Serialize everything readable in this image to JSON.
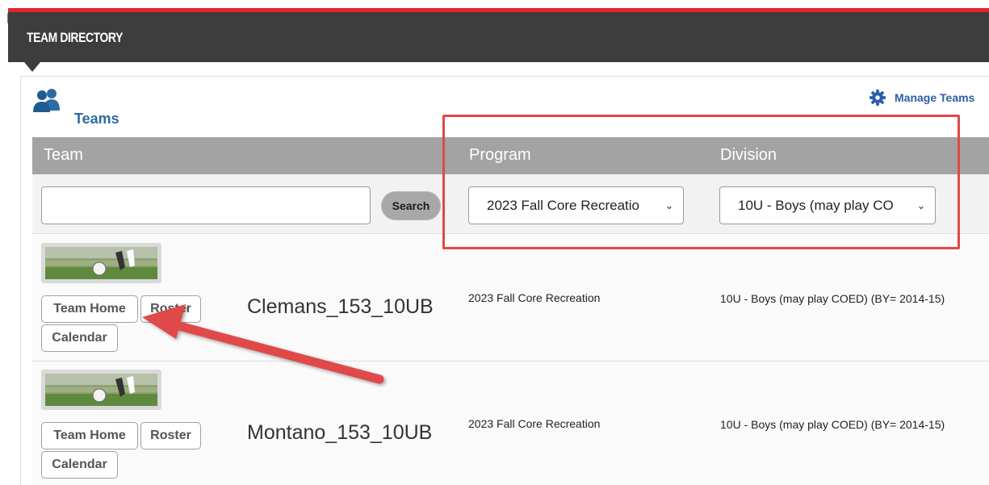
{
  "header": {
    "title": "TEAM DIRECTORY"
  },
  "section": {
    "title": "Teams",
    "manage_label": "Manage Teams"
  },
  "columns": {
    "team": "Team",
    "program": "Program",
    "division": "Division"
  },
  "filters": {
    "team_value": "",
    "search_label": "Search",
    "program_selected": "2023 Fall Core Recreatio",
    "division_selected": "10U - Boys (may play CO"
  },
  "rows": [
    {
      "team_name": "Clemans_153_10UB",
      "program": "2023 Fall Core Recreation",
      "division": "10U - Boys (may play COED) (BY= 2014-15)",
      "buttons": {
        "home": "Team Home",
        "roster": "Roster",
        "calendar": "Calendar"
      }
    },
    {
      "team_name": "Montano_153_10UB",
      "program": "2023 Fall Core Recreation",
      "division": "10U - Boys (may play COED) (BY= 2014-15)",
      "buttons": {
        "home": "Team Home",
        "roster": "Roster",
        "calendar": "Calendar"
      }
    }
  ],
  "colors": {
    "header_bg": "#3d3d3d",
    "accent_red": "#e4262c",
    "link_blue": "#2b5ea8",
    "table_header_bg": "#a3a3a3",
    "annotation_red": "#e04848"
  },
  "icons": [
    "teams-icon",
    "gear-icon",
    "chevron-down-icon",
    "mouse-cursor-icon",
    "annotation-arrow"
  ]
}
